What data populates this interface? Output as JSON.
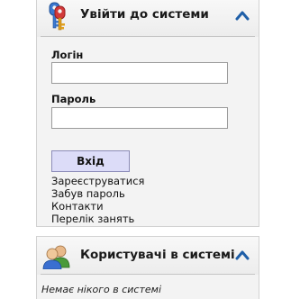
{
  "login_panel": {
    "title": "Увійти до системи",
    "header_icon": "keys-icon",
    "collapse_icon": "chevron-up-icon",
    "login_label": "Логін",
    "login_value": "",
    "password_label": "Пароль",
    "password_value": "",
    "submit_label": "Вхід",
    "links": [
      "Зареєструватися",
      "Забув пароль",
      "Контакти",
      "Перелік занять"
    ],
    "accent_color": "#1f5fa8",
    "button_color": "#dcdcf8"
  },
  "users_panel": {
    "title": "Користувачі в системі",
    "header_icon": "users-icon",
    "collapse_icon": "chevron-up-icon",
    "status_text": "Немає нікого в системі"
  }
}
